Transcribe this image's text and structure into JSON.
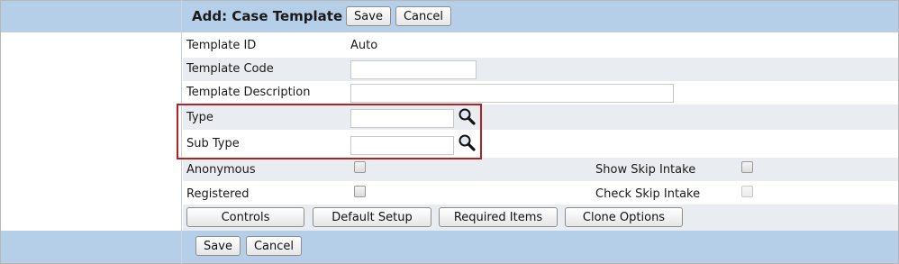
{
  "header": {
    "title": "Add: Case Template",
    "save_label": "Save",
    "cancel_label": "Cancel"
  },
  "form": {
    "template_id": {
      "label": "Template ID",
      "value": "Auto"
    },
    "template_code": {
      "label": "Template Code",
      "value": ""
    },
    "template_description": {
      "label": "Template Description",
      "value": ""
    },
    "type": {
      "label": "Type",
      "value": ""
    },
    "sub_type": {
      "label": "Sub Type",
      "value": ""
    },
    "anonymous": {
      "label": "Anonymous",
      "checked": false
    },
    "registered": {
      "label": "Registered",
      "checked": false
    },
    "show_skip_intake": {
      "label": "Show Skip Intake",
      "checked": false
    },
    "check_skip_intake": {
      "label": "Check Skip Intake",
      "checked": false,
      "disabled": true
    }
  },
  "actions": {
    "controls": "Controls",
    "default_setup": "Default Setup",
    "required_items": "Required Items",
    "clone_options": "Clone Options"
  },
  "footer": {
    "save_label": "Save",
    "cancel_label": "Cancel"
  },
  "icons": {
    "lookup": "magnifier-icon"
  },
  "colors": {
    "header_band": "#b6cfe9",
    "row_alt": "#e9edf2",
    "highlight_border": "#b22222"
  }
}
